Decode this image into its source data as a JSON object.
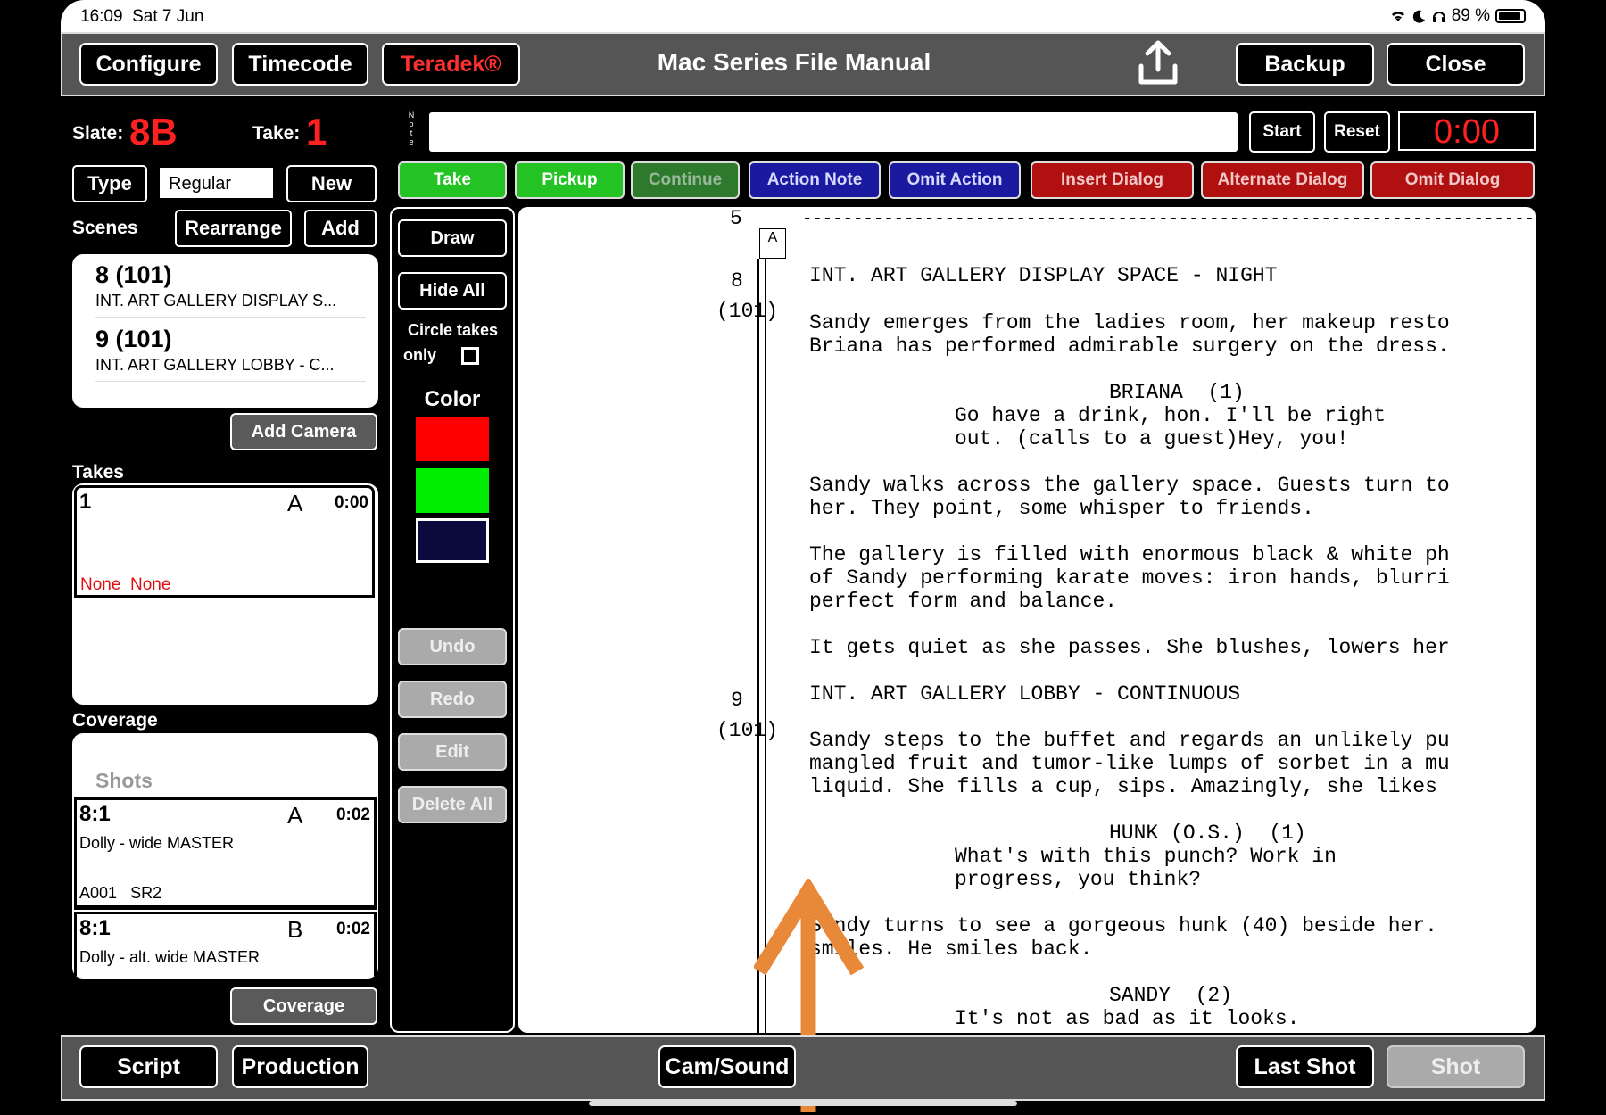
{
  "status_bar": {
    "time": "16:09",
    "date": "Sat 7 Jun",
    "battery": "89 %"
  },
  "header": {
    "configure": "Configure",
    "timecode": "Timecode",
    "teradek": "Teradek®",
    "title": "Mac Series File Manual",
    "backup": "Backup",
    "close": "Close"
  },
  "slate": {
    "slate_label": "Slate:",
    "slate_value": "8B",
    "take_label": "Take:",
    "take_value": "1"
  },
  "note": {
    "label": "Note",
    "value": "",
    "start": "Start",
    "reset": "Reset",
    "timer": "0:00"
  },
  "type_row": {
    "type": "Type",
    "value": "Regular",
    "new": "New"
  },
  "scenes": {
    "label": "Scenes",
    "rearrange": "Rearrange",
    "add": "Add",
    "items": [
      {
        "number": "8 (101)",
        "desc": "INT. ART GALLERY DISPLAY S..."
      },
      {
        "number": "9 (101)",
        "desc": "INT. ART GALLERY LOBBY - C..."
      }
    ],
    "add_camera": "Add Camera"
  },
  "takes": {
    "label": "Takes",
    "items": [
      {
        "num": "1",
        "cam": "A",
        "duration": "0:00",
        "status1": "None",
        "status2": "None"
      }
    ]
  },
  "coverage": {
    "label": "Coverage",
    "shots_label": "Shots",
    "items": [
      {
        "id": "8:1",
        "cam": "A",
        "duration": "0:02",
        "desc": "Dolly - wide MASTER",
        "roll": "A001",
        "sound": "SR2"
      },
      {
        "id": "8:1",
        "cam": "B",
        "duration": "0:02",
        "desc": "Dolly - alt. wide MASTER"
      }
    ],
    "button": "Coverage"
  },
  "take_buttons": [
    {
      "label": "Take",
      "bg": "#22c322",
      "fg": "#ffffff"
    },
    {
      "label": "Pickup",
      "bg": "#22c322",
      "fg": "#ffffff"
    },
    {
      "label": "Continue",
      "bg": "#2d7a2d",
      "fg": "#9ab89a"
    },
    {
      "label": "Action Note",
      "bg": "#1a1aa0",
      "fg": "#d8d8ff"
    },
    {
      "label": "Omit Action",
      "bg": "#1a1aa0",
      "fg": "#d8d8ff"
    },
    {
      "label": "Insert Dialog",
      "bg": "#b01010",
      "fg": "#f0c8c8"
    },
    {
      "label": "Alternate Dialog",
      "bg": "#b01010",
      "fg": "#f0c8c8"
    },
    {
      "label": "Omit Dialog",
      "bg": "#b01010",
      "fg": "#f0c8c8"
    }
  ],
  "tools": {
    "draw": "Draw",
    "hide_all": "Hide All",
    "circle_takes": "Circle takes",
    "only": "only",
    "color_label": "Color",
    "colors": [
      "#ff0000",
      "#00ee00",
      "#0a0a3c"
    ],
    "undo": "Undo",
    "redo": "Redo",
    "edit": "Edit",
    "delete_all": "Delete All"
  },
  "script": {
    "page_number": "5",
    "camera_tag": "A",
    "dashes": "--------------------------------------------------------------------------------",
    "scene8_num": "8",
    "scene8_ref": "(101)",
    "scene9_num": "9",
    "scene9_ref": "(101)",
    "lines": [
      "INT. ART GALLERY DISPLAY SPACE - NIGHT",
      "Sandy emerges from the ladies room, her makeup resto",
      "Briana has performed admirable surgery on the dress.",
      "BRIANA  (1)",
      "Go have a drink, hon. I'll be right",
      "out. (calls to a guest)Hey, you!",
      "Sandy walks across the gallery space. Guests turn to",
      "her. They point, some whisper to friends.",
      "The gallery is filled with enormous black & white ph",
      "of Sandy performing karate moves: iron hands, blurri",
      "perfect form and balance.",
      "It gets quiet as she passes. She blushes, lowers her",
      "INT. ART GALLERY LOBBY - CONTINUOUS",
      "Sandy steps to the buffet and regards an unlikely pu",
      "mangled fruit and tumor-like lumps of sorbet in a mu",
      "liquid. She fills a cup, sips. Amazingly, she likes",
      "HUNK (O.S.)  (1)",
      "What's with this punch? Work in",
      "progress, you think?",
      "Sandy turns to see a gorgeous hunk (40) beside her.",
      "smiles. He smiles back.",
      "SANDY  (2)",
      "It's not as bad as it looks."
    ]
  },
  "footer": {
    "script": "Script",
    "production": "Production",
    "cam_sound": "Cam/Sound",
    "last_shot": "Last Shot",
    "shot": "Shot"
  },
  "annotation_color": "#e8893a"
}
